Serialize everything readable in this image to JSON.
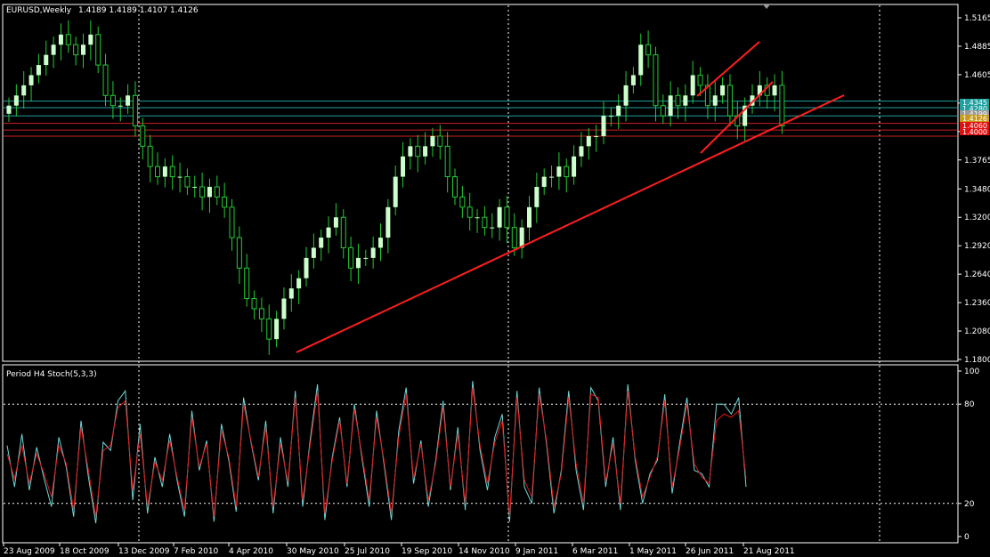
{
  "window": {
    "symbol_timeframe": "EURUSD,Weekly",
    "ohlc": "1.4189 1.4189 1.4107 1.4126"
  },
  "indicator": {
    "label": "Period H4 Stoch(5,3,3)"
  },
  "colors": {
    "background": "#000000",
    "frame": "#ffffff",
    "bull_candle": "#ccffcc",
    "wick": "#22cc33",
    "trendline": "#ff1e1e",
    "stoch_main": "#6fd7d7",
    "stoch_signal": "#e01818",
    "level_cyan": "#20a0a0",
    "level_red": "#cc2020"
  },
  "price_tags": [
    {
      "value": "1.4345",
      "bg": "#20a0a0",
      "fg": "#000000"
    },
    {
      "value": "1.4280",
      "bg": "#20a0a0",
      "fg": "#000000"
    },
    {
      "value": "1.4199",
      "bg": "#999999",
      "fg": "#000000"
    },
    {
      "value": "1.4126",
      "bg": "#c89a1a",
      "fg": "#000000"
    },
    {
      "value": "1.4060",
      "bg": "#e01010",
      "fg": "#ffffff"
    },
    {
      "value": "1.4000",
      "bg": "#e01010",
      "fg": "#ffffff"
    }
  ],
  "chart_data": [
    {
      "type": "candlestick",
      "title": "EURUSD,Weekly",
      "xlabel": "",
      "ylabel": "",
      "ylim": [
        1.18,
        1.5165
      ],
      "yticks": [
        1.5165,
        1.4885,
        1.4605,
        1.4325,
        1.4045,
        1.3765,
        1.348,
        1.32,
        1.292,
        1.264,
        1.236,
        1.208,
        1.18
      ],
      "ytick_labels": [
        "1.5165",
        "1.4885",
        "1.4605",
        "",
        "",
        "1.3765",
        "1.3480",
        "1.3200",
        "1.2920",
        "1.2640",
        "1.2360",
        "1.2080",
        "1.1800"
      ],
      "x_labels": [
        "23 Aug 2009",
        "18 Oct 2009",
        "13 Dec 2009",
        "7 Feb 2010",
        "4 Apr 2010",
        "30 May 2010",
        "25 Jul 2010",
        "19 Sep 2010",
        "14 Nov 2010",
        "9 Jan 2011",
        "6 Mar 2011",
        "1 May 2011",
        "26 Jun 2011",
        "21 Aug 2011"
      ],
      "grid": "vertical dotted at 13 Dec 2009, 9 Jan 2011 and right edge",
      "close": [
        1.43,
        1.44,
        1.45,
        1.46,
        1.47,
        1.48,
        1.49,
        1.5,
        1.49,
        1.48,
        1.49,
        1.5,
        1.47,
        1.44,
        1.43,
        1.43,
        1.44,
        1.41,
        1.39,
        1.37,
        1.36,
        1.37,
        1.36,
        1.36,
        1.35,
        1.35,
        1.34,
        1.35,
        1.34,
        1.33,
        1.3,
        1.27,
        1.24,
        1.23,
        1.22,
        1.2,
        1.22,
        1.24,
        1.25,
        1.26,
        1.28,
        1.29,
        1.3,
        1.31,
        1.32,
        1.29,
        1.27,
        1.28,
        1.28,
        1.29,
        1.3,
        1.33,
        1.36,
        1.38,
        1.39,
        1.38,
        1.39,
        1.4,
        1.39,
        1.36,
        1.34,
        1.33,
        1.32,
        1.32,
        1.31,
        1.31,
        1.33,
        1.31,
        1.29,
        1.31,
        1.33,
        1.35,
        1.36,
        1.36,
        1.37,
        1.36,
        1.38,
        1.39,
        1.4,
        1.4,
        1.42,
        1.42,
        1.43,
        1.45,
        1.46,
        1.49,
        1.48,
        1.43,
        1.42,
        1.44,
        1.43,
        1.44,
        1.46,
        1.45,
        1.43,
        1.44,
        1.45,
        1.42,
        1.41,
        1.43,
        1.44,
        1.45,
        1.44,
        1.45,
        1.41
      ],
      "trendlines": [
        {
          "from": [
            "30 May 2010",
            1.18
          ],
          "to": [
            "after 21 Aug 2011",
            1.44
          ]
        },
        {
          "from": [
            "26 Jun 2011",
            1.38
          ],
          "to": [
            "after 21 Aug 2011",
            1.46
          ]
        },
        {
          "from": [
            "26 Jun 2011",
            1.43
          ],
          "to": [
            "after 21 Aug 2011",
            1.49
          ]
        }
      ],
      "levels": [
        1.4345,
        1.428,
        1.4199,
        1.4126,
        1.406,
        1.4
      ]
    },
    {
      "type": "line",
      "title": "Period H4 Stoch(5,3,3)",
      "ylim": [
        0,
        100
      ],
      "yticks": [
        100,
        80,
        20,
        0
      ],
      "ytick_labels": [
        "100",
        "80",
        "20",
        "0"
      ],
      "levels": [
        80,
        20
      ],
      "series": [
        {
          "values": [
            55,
            30,
            62,
            28,
            54,
            35,
            18,
            60,
            42,
            12,
            70,
            36,
            8,
            57,
            52,
            82,
            88,
            22,
            68,
            14,
            48,
            30,
            62,
            34,
            12,
            76,
            40,
            58,
            9,
            68,
            46,
            15,
            84,
            57,
            34,
            70,
            14,
            60,
            30,
            88,
            18,
            58,
            92,
            10,
            48,
            72,
            30,
            80,
            48,
            18,
            76,
            44,
            10,
            64,
            90,
            32,
            58,
            18,
            46,
            82,
            28,
            66,
            16,
            94,
            52,
            28,
            60,
            74,
            9,
            88,
            30,
            20,
            90,
            56,
            14,
            40,
            88,
            40,
            16,
            90,
            82,
            30,
            60,
            16,
            92,
            46,
            20,
            38,
            46,
            86,
            26,
            56,
            84,
            40,
            38,
            30,
            80,
            80,
            74,
            84,
            30
          ]
        },
        {
          "values": [
            50,
            35,
            55,
            32,
            50,
            38,
            24,
            55,
            44,
            16,
            66,
            40,
            12,
            52,
            55,
            78,
            82,
            28,
            62,
            18,
            45,
            34,
            58,
            36,
            16,
            72,
            42,
            56,
            12,
            64,
            48,
            18,
            80,
            58,
            36,
            66,
            18,
            56,
            33,
            84,
            22,
            55,
            88,
            14,
            46,
            70,
            32,
            77,
            50,
            22,
            72,
            46,
            14,
            60,
            86,
            35,
            56,
            22,
            44,
            78,
            30,
            62,
            20,
            90,
            55,
            32,
            57,
            70,
            12,
            84,
            34,
            24,
            86,
            58,
            18,
            38,
            84,
            44,
            20,
            86,
            84,
            33,
            56,
            20,
            88,
            48,
            24,
            36,
            48,
            82,
            30,
            53,
            80,
            44,
            36,
            32,
            70,
            74,
            72,
            76,
            35
          ]
        }
      ]
    }
  ]
}
